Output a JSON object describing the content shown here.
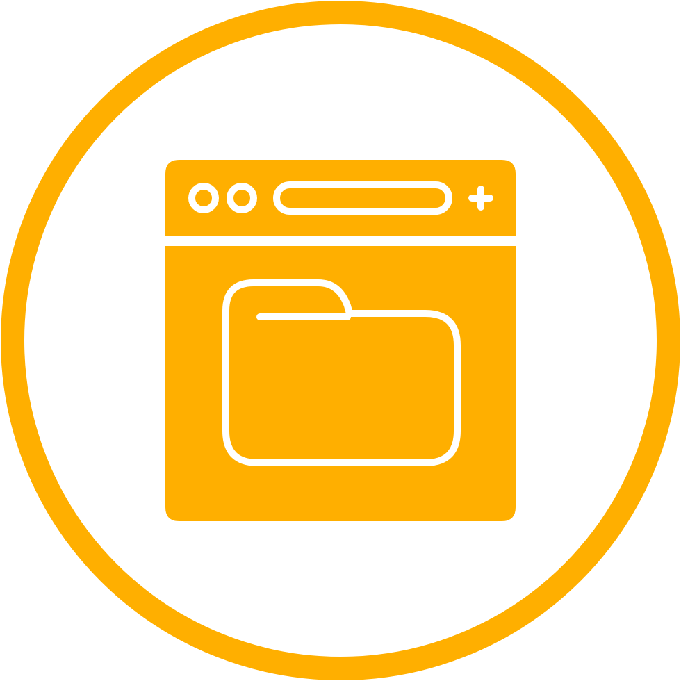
{
  "icon": {
    "name": "browser-folder-icon",
    "accent_color": "#FFAF00",
    "background_color": "#FFFFFF",
    "parts": {
      "ring": "circle-ring-icon",
      "window": "browser-window-icon",
      "title_bar": "browser-title-bar",
      "buttons": [
        "window-dot-icon",
        "window-dot-icon"
      ],
      "address_bar": "address-bar-icon",
      "new_tab": "plus-icon",
      "content": "folder-icon"
    }
  }
}
